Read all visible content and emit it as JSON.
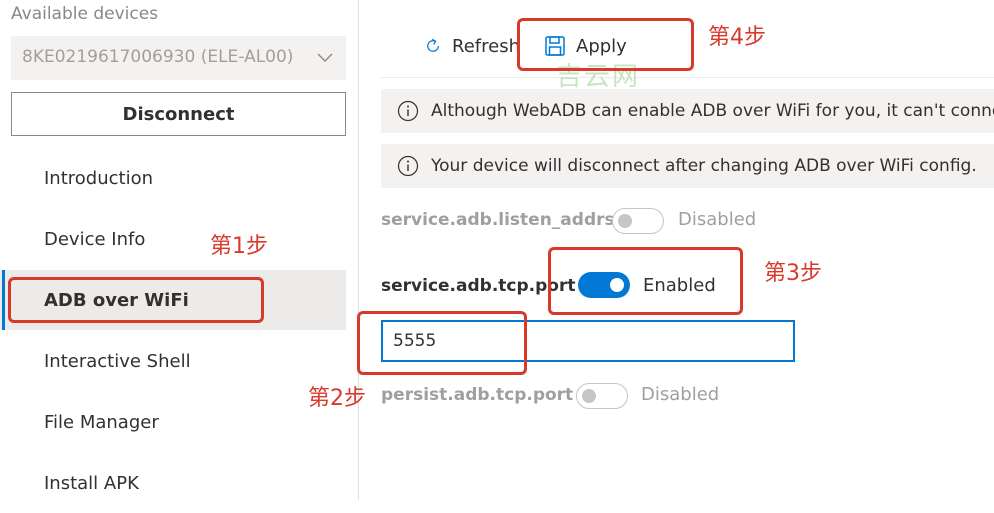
{
  "sidebar": {
    "devices_label": "Available devices",
    "selected_device": "8KE0219617006930 (ELE-AL00)",
    "disconnect_label": "Disconnect",
    "nav": [
      {
        "label": "Introduction"
      },
      {
        "label": "Device Info"
      },
      {
        "label": "ADB over WiFi",
        "active": true
      },
      {
        "label": "Interactive Shell"
      },
      {
        "label": "File Manager"
      },
      {
        "label": "Install APK"
      }
    ]
  },
  "toolbar": {
    "refresh_label": "Refresh",
    "apply_label": "Apply"
  },
  "info": {
    "message1": "Although WebADB can enable ADB over WiFi for you, it can't connect to it.",
    "message2": "Your device will disconnect after changing ADB over WiFi config."
  },
  "settings": {
    "listen_addrs": {
      "label": "service.adb.listen_addrs",
      "state": "Disabled",
      "enabled": false
    },
    "tcp_port": {
      "label": "service.adb.tcp.port",
      "state": "Enabled",
      "enabled": true,
      "value": "5555"
    },
    "persist_port": {
      "label": "persist.adb.tcp.port",
      "state": "Disabled",
      "enabled": false
    }
  },
  "annotations": {
    "step1": "第1步",
    "step2": "第2步",
    "step3": "第3步",
    "step4": "第4步",
    "watermark": "吉云网"
  },
  "colors": {
    "accent": "#0078d4",
    "annotation_red": "#d9392b"
  }
}
